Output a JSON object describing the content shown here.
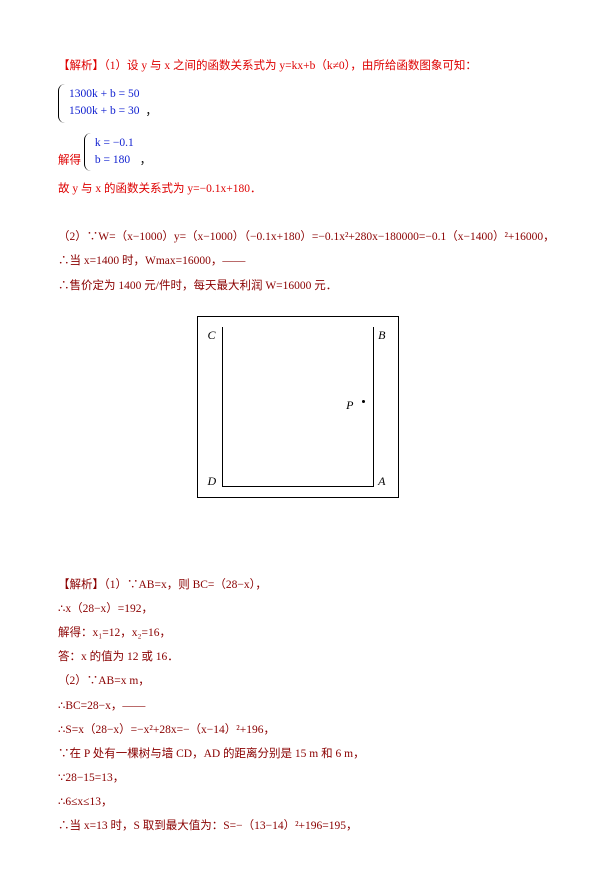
{
  "line1": "【解析】（1）设 y 与 x 之间的函数关系式为 y=kx+b（k≠0），由所给函数图象可知：",
  "sys1_row1": "1300k + b = 50",
  "sys1_row2": "1500k + b = 30",
  "sys1_suffix": "，",
  "solve_prefix": "解得",
  "sys2_row1": "k = −0.1",
  "sys2_row2": "b = 180",
  "sys2_suffix": "，",
  "line4": "故 y 与 x 的函数关系式为 y=−0.1x+180．",
  "line5": "（2）∵W=（x−1000）y=（x−1000）（−0.1x+180）=−0.1x²+280x−180000=−0.1（x−1400）²+16000，",
  "line6": "∴当 x=1400 时，Wmax=16000，——",
  "line7": "∴售价定为 1400 元/件时，每天最大利润 W=16000 元．",
  "s_line1": "【解析】（1）∵AB=x，则 BC=（28−x），",
  "s_line2": "∴x（28−x）=192，",
  "s_line3": "解得：x₁=12，x₂=16，",
  "s_line4": "答：x 的值为 12 或 16．",
  "s_line5": "（2）∵AB=x m，",
  "s_line6": "∴BC=28−x，——",
  "s_line7": "∴S=x（28−x）=−x²+28x=−（x−14）²+196，",
  "s_line8": "∵在 P 处有一棵树与墙 CD，AD 的距离分别是 15 m 和 6 m，",
  "s_line9": "∵28−15=13，",
  "s_line10": "∴6≤x≤13，",
  "s_line11": "∴当 x=13 时，S 取到最大值为：S=−（13−14）²+196=195，",
  "diagram": {
    "C": "C",
    "B": "B",
    "D": "D",
    "A": "A",
    "P": "P"
  }
}
